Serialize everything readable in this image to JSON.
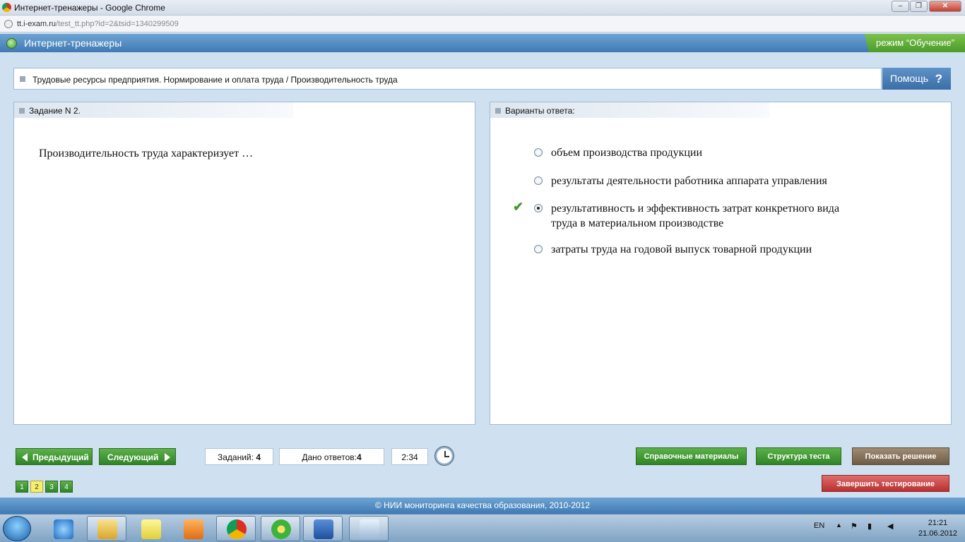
{
  "window": {
    "title": "Интернет-тренажеры - Google Chrome",
    "url_host": "tt.i-exam.ru",
    "url_path": "/test_tt.php?id=2&tsid=1340299509"
  },
  "app": {
    "title": "Интернет-тренажеры",
    "mode": "режим “Обучение”",
    "help": "Помощь",
    "help_icon": "?"
  },
  "breadcrumb": "Трудовые ресурсы предприятия. Нормирование и оплата труда / Производительность труда",
  "task": {
    "header": "Задание N 2.",
    "question": "Производительность труда характеризует …"
  },
  "answers": {
    "header": "Варианты ответа:",
    "options": [
      {
        "text": "объем производства продукции",
        "selected": false
      },
      {
        "text": "результаты деятельности работника аппарата управления",
        "selected": false
      },
      {
        "text": "результативность и эффективность затрат конкретного вида труда в материальном производстве",
        "selected": true
      },
      {
        "text": "затраты труда на годовой выпуск товарной продукции",
        "selected": false
      }
    ],
    "correct_icon": "check-mark-icon"
  },
  "nav": {
    "prev": "Предыдущий",
    "next": "Следующий"
  },
  "stats": {
    "tasks_label": "Заданий:",
    "tasks_value": "4",
    "answered_label": "Дано ответов:",
    "answered_value": "4",
    "timer": "2:34"
  },
  "buttons": {
    "reference": "Справочные материалы",
    "structure": "Структура теста",
    "show_solution": "Показать решение",
    "finish": "Завершить тестирование"
  },
  "pages": [
    "1",
    "2",
    "3",
    "4"
  ],
  "current_page": "2",
  "footer": "© НИИ мониторинга качества образования, 2010-2012",
  "taskbar": {
    "lang": "EN",
    "time": "21:21",
    "date": "21.06.2012"
  },
  "window_controls": {
    "minimize": "–",
    "maximize": "❐",
    "close": "✕"
  },
  "colors": {
    "header_blue": "#3f7ab4",
    "green": "#2f8426",
    "red": "#b8302f"
  }
}
